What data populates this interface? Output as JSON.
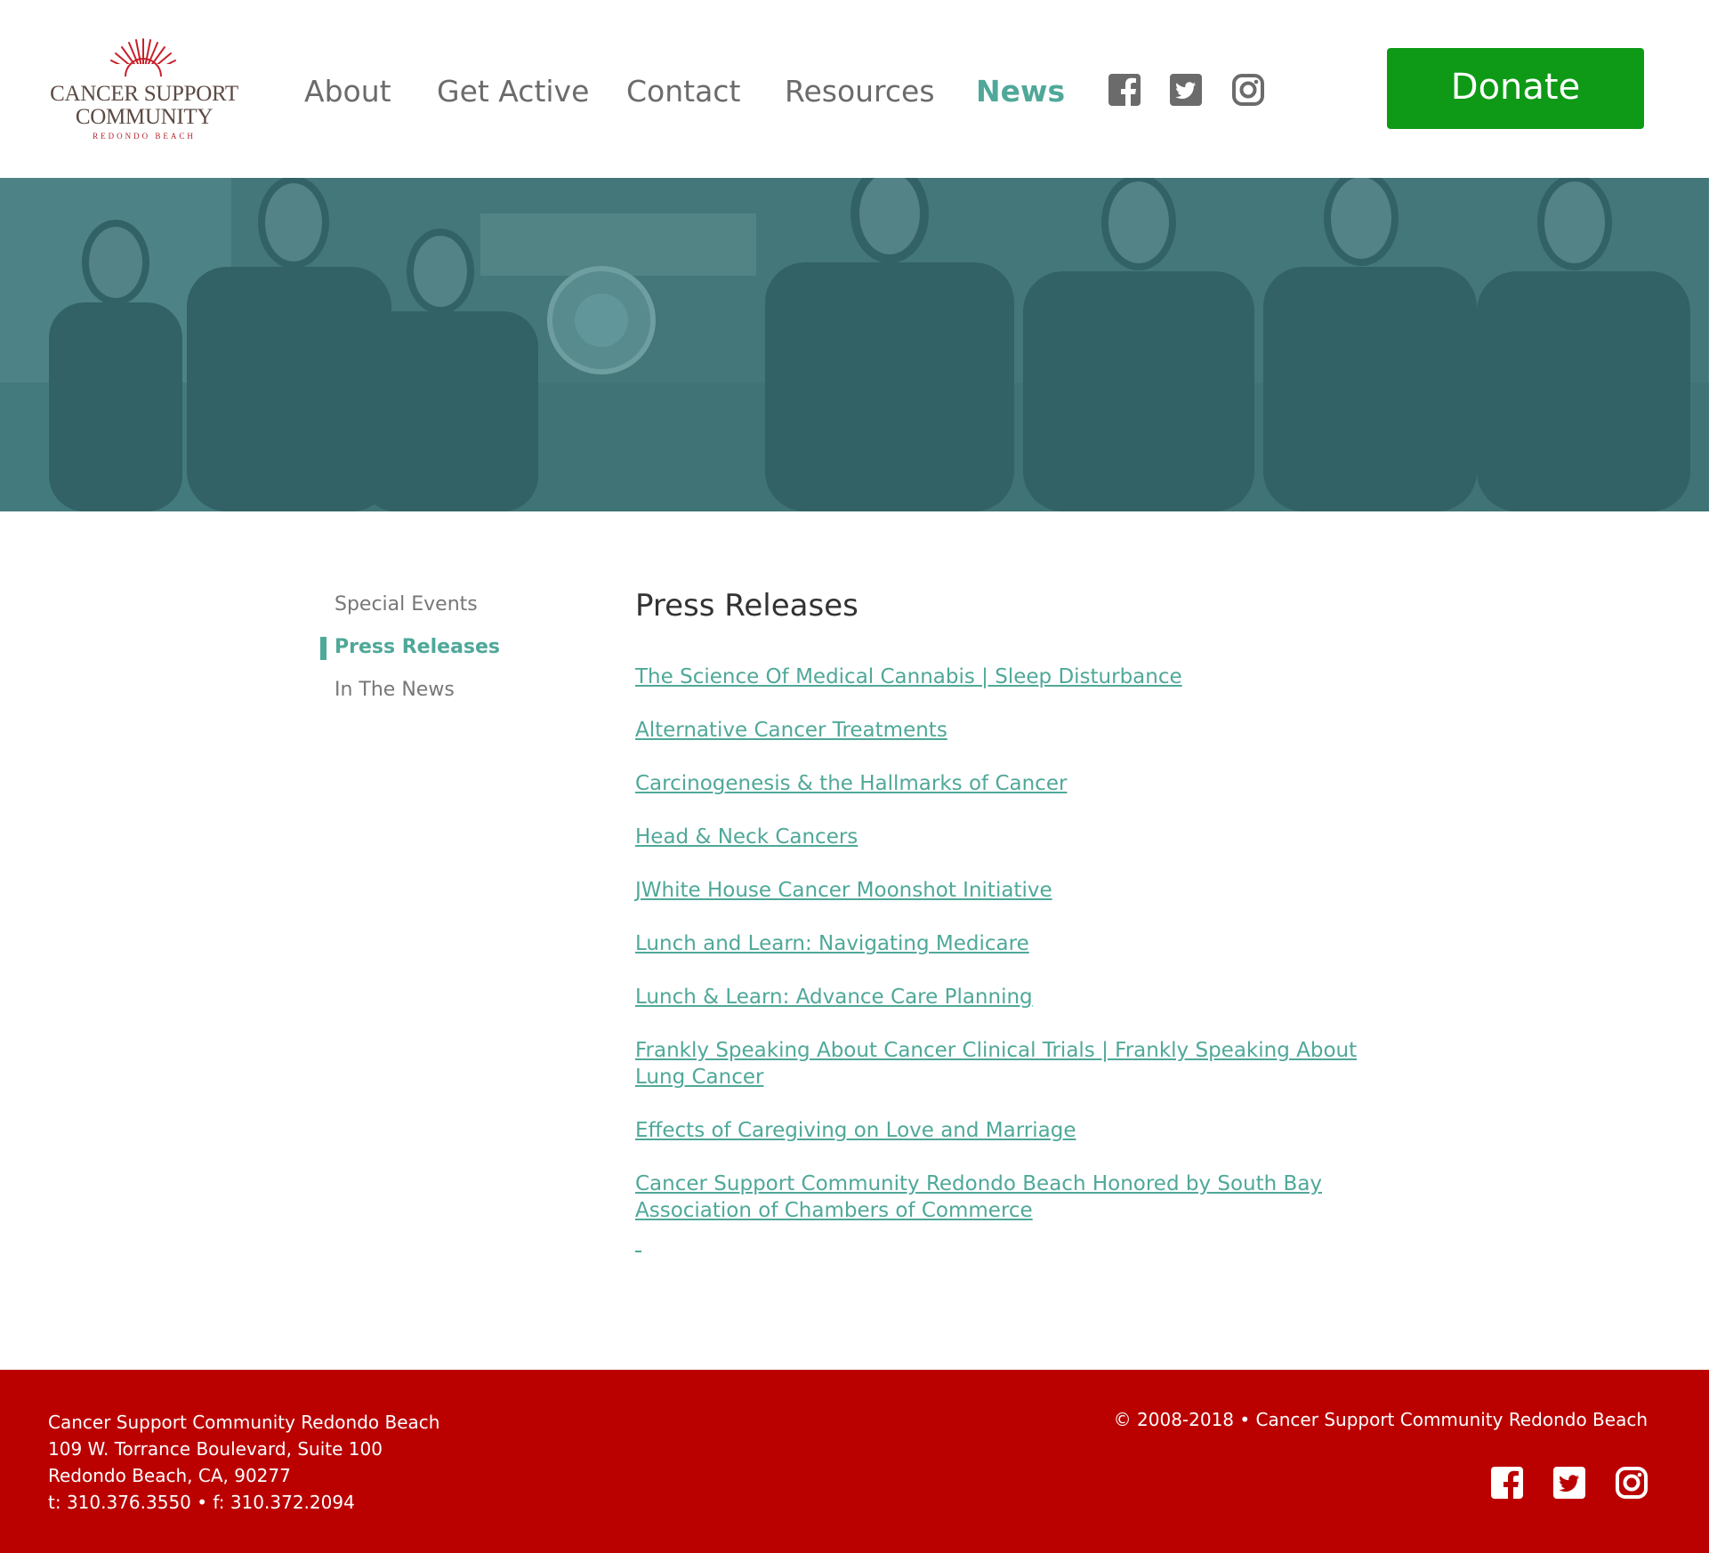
{
  "logo": {
    "line1": "CANCER SUPPORT",
    "line2": "COMMUNITY",
    "line3": "REDONDO BEACH",
    "brand_red": "#b4232a",
    "brand_brown": "#5c4a44"
  },
  "nav": {
    "items": [
      {
        "label": "About"
      },
      {
        "label": "Get Active"
      },
      {
        "label": "Contact"
      },
      {
        "label": "Resources"
      },
      {
        "label": "News",
        "active": true
      }
    ],
    "social_icons": [
      "facebook-icon",
      "twitter-icon",
      "instagram-icon"
    ],
    "donate_label": "Donate",
    "accent_color": "#4fa899",
    "donate_color": "#0e9a16"
  },
  "sidebar": {
    "items": [
      {
        "label": "Special Events"
      },
      {
        "label": "Press Releases",
        "active": true
      },
      {
        "label": "In The News"
      }
    ]
  },
  "main": {
    "title": "Press Releases",
    "releases": [
      "The Science Of Medical Cannabis | Sleep Disturbance",
      "Alternative Cancer Treatments",
      "Carcinogenesis & the Hallmarks of Cancer",
      "Head & Neck Cancers",
      "JWhite House Cancer Moonshot Initiative",
      "Lunch and Learn: Navigating Medicare",
      "Lunch & Learn: Advance Care Planning",
      "Frankly Speaking About Cancer Clinical Trials | Frankly Speaking About Lung Cancer",
      "Effects of Caregiving on Love and Marriage",
      "Cancer Support Community Redondo Beach Honored by South Bay Association of Chambers of Commerce"
    ]
  },
  "footer": {
    "address_lines": [
      "Cancer Support Community Redondo Beach",
      "109 W. Torrance Boulevard, Suite 100",
      "Redondo Beach, CA, 90277",
      "t: 310.376.3550 • f: 310.372.2094"
    ],
    "copyright": "© 2008-2018 • Cancer Support Community Redondo Beach",
    "social_icons": [
      "facebook-icon",
      "twitter-icon",
      "instagram-icon"
    ],
    "background_color": "#bb0000"
  }
}
